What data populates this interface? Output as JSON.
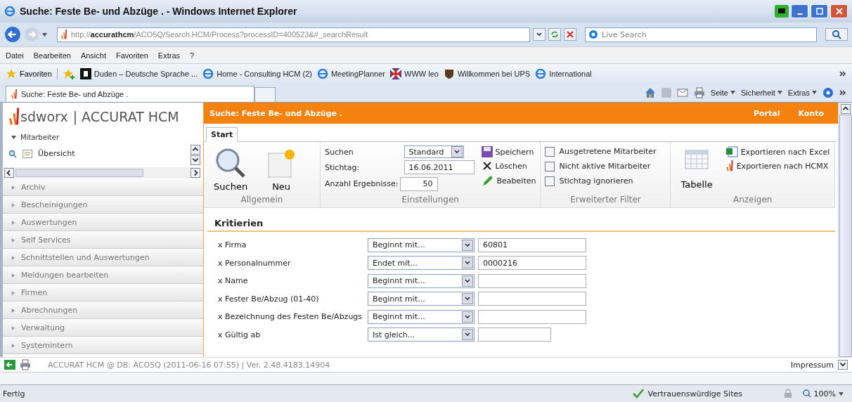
{
  "window": {
    "title": "Suche: Feste Be- und Abzüge . - Windows Internet Explorer"
  },
  "address_bar": {
    "url": "http://**accurathcm**/ACO5Q/Search.HCM/Process?processID=400523&#_searchResult",
    "search_placeholder": "Live Search"
  },
  "menu": [
    "Datei",
    "Bearbeiten",
    "Ansicht",
    "Favoriten",
    "Extras",
    "?"
  ],
  "favorites_bar": {
    "label": "Favoriten",
    "items": [
      {
        "label": "Duden – Deutsche Sprache ...",
        "kind": "duden"
      },
      {
        "label": "Home - Consulting HCM (2)",
        "kind": "ie"
      },
      {
        "label": "MeetingPlanner",
        "kind": "ie"
      },
      {
        "label": "WWW leo",
        "kind": "leo"
      },
      {
        "label": "Willkommen bei UPS",
        "kind": "ups"
      },
      {
        "label": "International",
        "kind": "ie"
      }
    ]
  },
  "browser_tab": {
    "label": "Suche: Feste Be- und Abzüge ."
  },
  "command_bar": [
    "Seite",
    "Sicherheit",
    "Extras"
  ],
  "app": {
    "brand": "sdworx",
    "product": "| ACCURAT HCM",
    "tree": {
      "label": "Mitarbeiter",
      "expanded": true,
      "children": [
        {
          "label": "Übersicht"
        }
      ]
    },
    "accordion": [
      "Archiv",
      "Bescheinigungen",
      "Auswertungen",
      "Self Services",
      "Schnittstellen und Auswertungen",
      "Meldungen bearbeiten",
      "Firmen",
      "Abrechnungen",
      "Verwaltung",
      "Systemintern"
    ],
    "page_title": "Suche: Feste Be- und Abzüge .",
    "header_links": [
      "Portal",
      "Konto"
    ],
    "ribbon_tabs": [
      {
        "label": "Start",
        "selected": true
      }
    ],
    "ribbon": {
      "allgemein": {
        "title": "Allgemein",
        "buttons": [
          "Suchen",
          "Neu"
        ]
      },
      "einstellungen": {
        "title": "Einstellungen",
        "search_label": "Suchen",
        "search_value": "Standard",
        "date_label": "Stichtag:",
        "date_value": "16.06.2011",
        "count_label": "Anzahl Ergebnisse:",
        "count_value": "50",
        "actions": [
          {
            "label": "Speichern",
            "kind": "save"
          },
          {
            "label": "Löschen",
            "kind": "delete"
          },
          {
            "label": "Beabeiten",
            "kind": "edit"
          }
        ]
      },
      "filter": {
        "title": "Erweiterter Filter",
        "options": [
          {
            "label": "Ausgetretene Mitarbeiter",
            "checked": false
          },
          {
            "label": "Nicht aktive Mitarbeiter",
            "checked": false
          },
          {
            "label": "Stichtag ignorieren",
            "checked": false
          }
        ]
      },
      "anzeigen": {
        "title": "Anzeigen",
        "table_button": "Tabelle",
        "exports": [
          {
            "label": "Exportieren nach Excel",
            "kind": "excel"
          },
          {
            "label": "Exportieren nach HCMX",
            "kind": "hcmx"
          }
        ]
      }
    },
    "criteria_title": "Kritierien",
    "criteria": [
      {
        "label": "x Firma",
        "operator": "Beginnt mit...",
        "value": "60801",
        "kind": "text"
      },
      {
        "label": "x Personalnummer",
        "operator": "Endet mit...",
        "value": "0000216",
        "kind": "text"
      },
      {
        "label": "x Name",
        "operator": "Beginnt mit...",
        "kind": "text"
      },
      {
        "label": "x Fester Be/Abzug (01-40)",
        "operator": "Beginnt mit...",
        "kind": "text"
      },
      {
        "label": "x Bezeichnung des Festen Be/Abzugs",
        "operator": "Beginnt mit...",
        "kind": "text"
      },
      {
        "label": "x Gültig ab",
        "operator": "Ist gleich...",
        "kind": "date"
      }
    ],
    "footer": "ACCURAT HCM @ DB: ACO5Q (2011-06-16 07:55) | Ver. 2.48.4183.14904",
    "footer_link": "Impressum"
  },
  "status_bar": {
    "text": "Fertig",
    "zone": "Vertrauenswürdige Sites",
    "zoom": "100%"
  }
}
